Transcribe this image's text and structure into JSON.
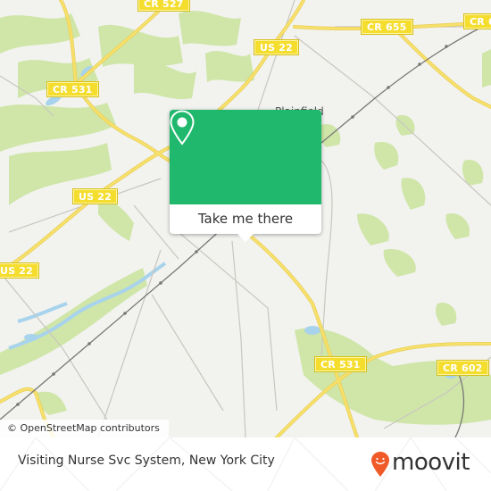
{
  "map": {
    "place_labels": [
      {
        "name": "Plainfield"
      }
    ],
    "route_shields": [
      {
        "label": "CR 527"
      },
      {
        "label": "CR 655"
      },
      {
        "label": "CR 6"
      },
      {
        "label": "US 22"
      },
      {
        "label": "CR 531"
      },
      {
        "label": "US 22"
      },
      {
        "label": "US 22"
      },
      {
        "label": "CR 531"
      },
      {
        "label": "CR 602"
      }
    ],
    "attribution": "© OpenStreetMap contributors",
    "colors": {
      "land": "#f2f2ef",
      "park": "#cfe6a8",
      "water": "#a8d3ec",
      "major_road": "#f7e06b",
      "minor_road": "#c9c6c0",
      "rail": "#777777"
    }
  },
  "popup": {
    "icon": "map-pin-icon",
    "action_label": "Take me there",
    "accent_color": "#1fb86c"
  },
  "footer": {
    "title": "Visiting Nurse Svc System, New York City",
    "brand": "moovit",
    "brand_color": "#f05a28"
  }
}
